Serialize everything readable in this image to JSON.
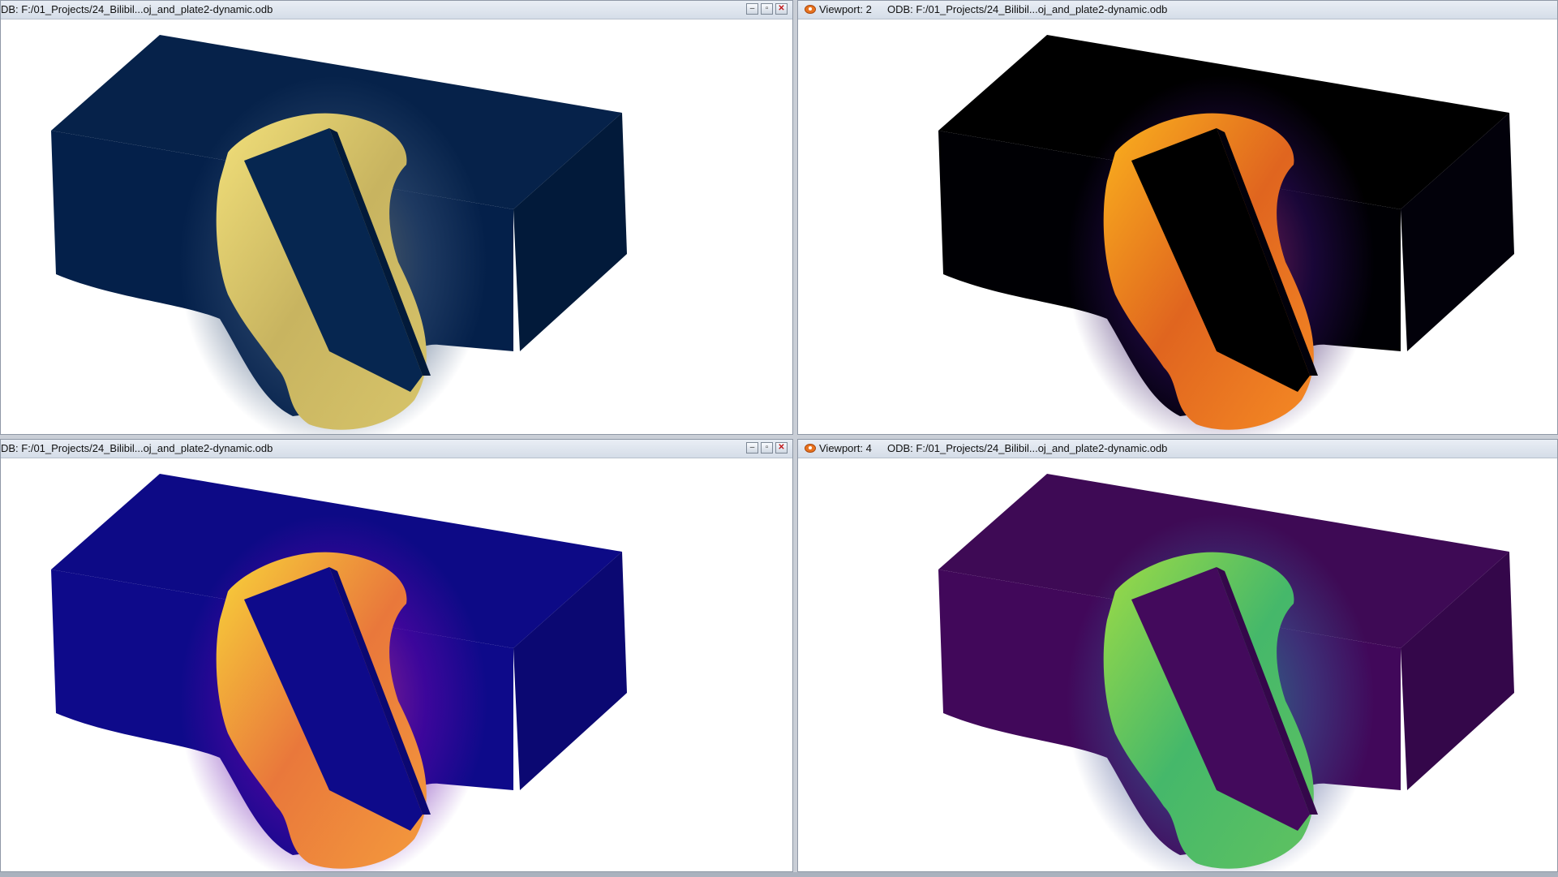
{
  "viewports": [
    {
      "id": "vp1",
      "title": "DB: F:/01_Projects/24_Bilibil...oj_and_plate2-dynamic.odb",
      "label": "",
      "colormap": "cividis"
    },
    {
      "id": "vp2",
      "label": "Viewport: 2",
      "title": "ODB: F:/01_Projects/24_Bilibil...oj_and_plate2-dynamic.odb",
      "colormap": "inferno"
    },
    {
      "id": "vp3",
      "title": "DB: F:/01_Projects/24_Bilibil...oj_and_plate2-dynamic.odb",
      "label": "",
      "colormap": "plasma"
    },
    {
      "id": "vp4",
      "label": "Viewport: 4",
      "title": "ODB: F:/01_Projects/24_Bilibil...oj_and_plate2-dynamic.odb",
      "colormap": "viridis"
    }
  ],
  "window_buttons": {
    "minimize": "–",
    "restore": "▫",
    "close": "✕"
  },
  "palettes": {
    "cividis": {
      "top": "#06224a",
      "front": "#04204a",
      "side": "#021a3a",
      "hole": "#062650",
      "mid1": "#2f4a70",
      "mid2": "#7a7a6a",
      "hot1": "#c8b460",
      "hot2": "#f2e07a",
      "hot3": "#d7c46a"
    },
    "inferno": {
      "top": "#000000",
      "front": "#000004",
      "side": "#02010a",
      "hole": "#000000",
      "mid1": "#2a0b5a",
      "mid2": "#b5306a",
      "hot1": "#e0651f",
      "hot2": "#fbb31d",
      "hot3": "#f58a24"
    },
    "plasma": {
      "top": "#0d0a86",
      "front": "#0e0a8a",
      "side": "#0b0872",
      "hole": "#0e0a8a",
      "mid1": "#5b04a6",
      "mid2": "#c63f83",
      "hot1": "#e9783b",
      "hot2": "#f8d43a",
      "hot3": "#f49a3c"
    },
    "viridis": {
      "top": "#3e0a55",
      "front": "#41085a",
      "side": "#34074a",
      "hole": "#430a5c",
      "mid1": "#3b4a8a",
      "mid2": "#1f8f8c",
      "hot1": "#45b86a",
      "hot2": "#9fdc45",
      "hot3": "#60c260"
    }
  }
}
